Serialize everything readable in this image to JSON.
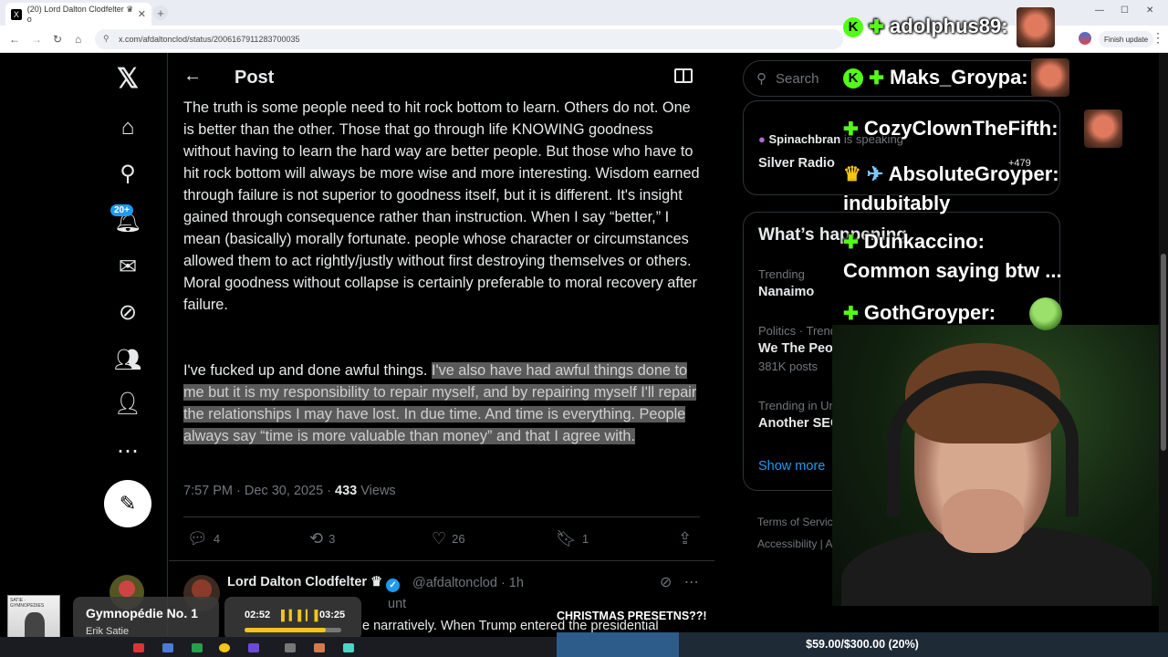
{
  "browser": {
    "tab_title": "(20) Lord Dalton Clodfelter ♛ o",
    "tab_favicon": "X",
    "url": "x.com/afdaltonclod/status/2006167911283700035",
    "finish_update": "Finish update"
  },
  "nav": {
    "notifications_badge": "20+"
  },
  "header": {
    "title": "Post"
  },
  "post": {
    "paragraph1": "The truth is some people need to hit rock bottom to learn. Others do not. One is better than the other. Those that go through life KNOWING goodness without having to learn the hard way are better people. But those who have to hit rock bottom will always be more wise and more interesting. Wisdom earned through failure is not superior to goodness itself, but it is different. It's insight gained through consequence rather than instruction. When I say “better,” I mean (basically) morally fortunate. people whose character or circumstances allowed them to act rightly/justly without first destroying themselves or others. Moral goodness without collapse is certainly preferable to moral recovery after failure.",
    "paragraph2_plain": "I've fucked up and done awful things.",
    "paragraph2_highlighted": "I've also have had awful things done to me but it is my responsibility to repair myself, and by repairing myself I'll repair the relationships I may have lost. In due time. And time is everything. People always say “time is more valuable than money” and that I agree with.",
    "timestamp": "7:57 PM · Dec 30, 2025 ·",
    "views_count": "433",
    "views_label": "Views",
    "replies": "4",
    "reposts": "3",
    "likes": "26",
    "bookmarks": "1"
  },
  "reply": {
    "name": "Lord Dalton Clodfelter ♛",
    "handle": "@afdaltonclod · 1h",
    "subline": "unt",
    "text": "e narratively. When Trump entered the presidential"
  },
  "sidebar": {
    "search_placeholder": "Search",
    "space_host": "Spinachbran",
    "space_status": "is speaking",
    "space_title": "Silver Radio",
    "space_count": "+479",
    "whats_happening": "What’s happening",
    "trends": [
      {
        "label": "Trending",
        "title": "Nanaimo",
        "count": ""
      },
      {
        "label": "Politics · Trending",
        "title": "We The People",
        "count": "381K posts"
      },
      {
        "label": "Trending in United States",
        "title": "Another SEC",
        "count": ""
      }
    ],
    "show_more": "Show more",
    "footer_line1": "Terms of Service  |  Pri",
    "footer_line2": "Accessibility  |  Ad"
  },
  "chat": {
    "messages": [
      {
        "user": "adolphus89:",
        "text": ""
      },
      {
        "user": "Maks_Groypa:",
        "text": ""
      },
      {
        "user": "CozyClownTheFifth:",
        "text": ""
      },
      {
        "user": "AbsoluteGroyper:",
        "text": "indubitably"
      },
      {
        "user": "Dunkaccino:",
        "text": "Common saying btw ..."
      },
      {
        "user": "GothGroyper:",
        "text": ""
      }
    ]
  },
  "music": {
    "album_text": "SATIE · GYMNOPEDIES",
    "title": "Gymnopédie No. 1",
    "artist": "Erik Satie",
    "elapsed": "02:52",
    "duration": "03:25",
    "progress": 0.84
  },
  "stream": {
    "banner": "CHRISTMAS PRESETNS??!",
    "donation_text": "$59.00/$300.00 (20%)",
    "donation_fraction": 0.2
  },
  "colors": {
    "accent": "#1d9bf0",
    "kick_green": "#53fc18",
    "highlight": "#5a5a5a"
  }
}
